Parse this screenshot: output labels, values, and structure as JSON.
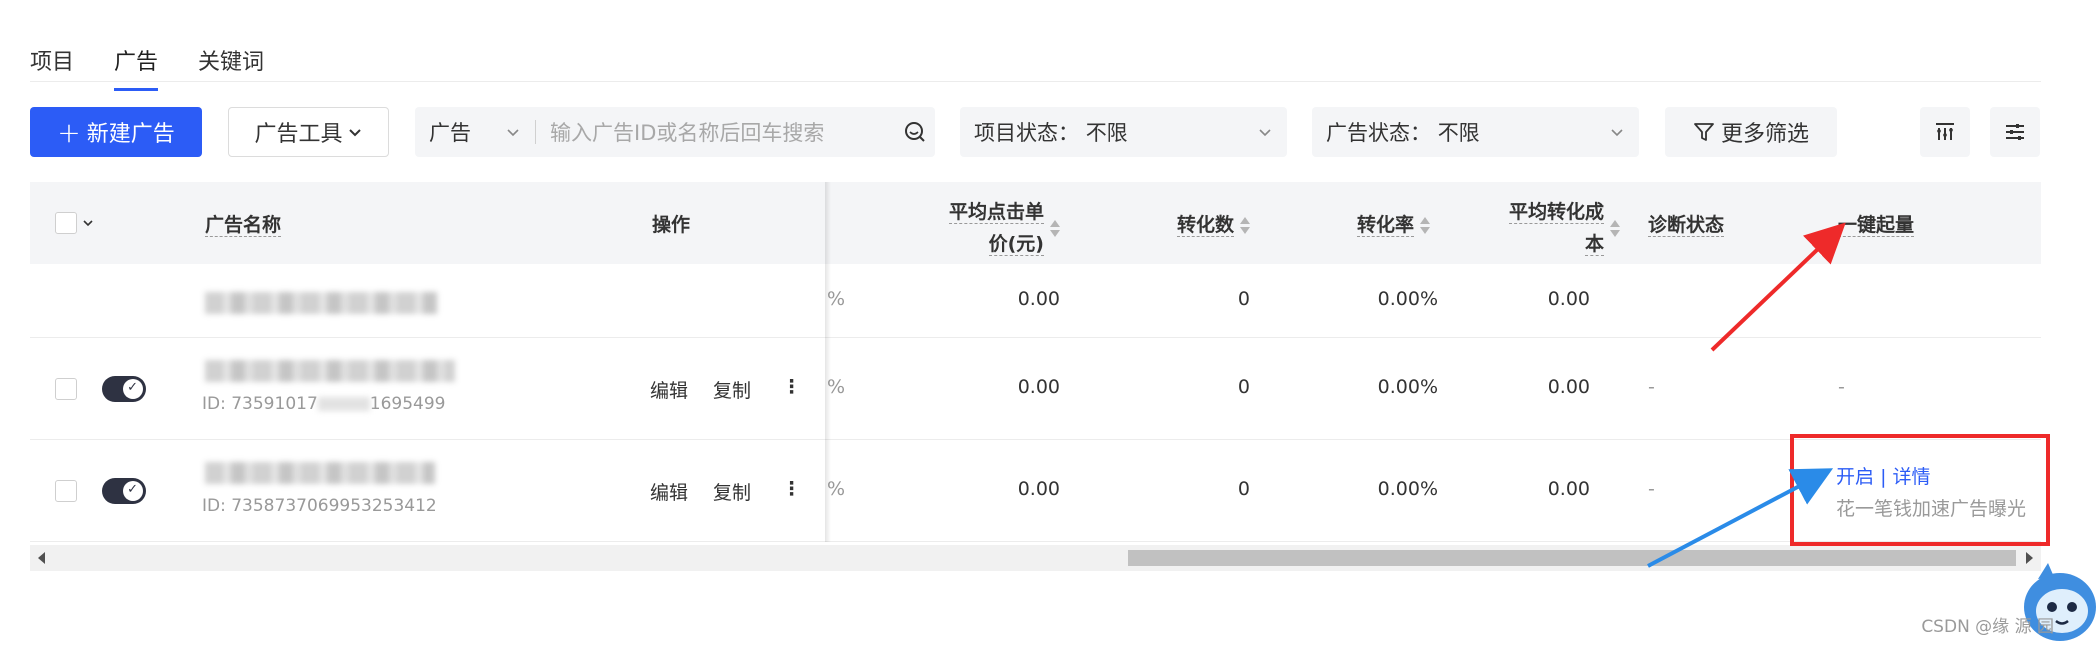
{
  "tabs": [
    {
      "label": "项目"
    },
    {
      "label": "广告",
      "active": true
    },
    {
      "label": "关键词"
    }
  ],
  "toolbar": {
    "new_ad_label": "新建广告",
    "ad_tools_label": "广告工具",
    "search_scope": "广告",
    "search_placeholder": "输入广告ID或名称后回车搜索",
    "project_status_label": "项目状态：",
    "project_status_value": "不限",
    "ad_status_label": "广告状态：",
    "ad_status_value": "不限",
    "more_filters_label": "更多筛选"
  },
  "table": {
    "headers": {
      "name": "广告名称",
      "actions": "操作",
      "partial": "",
      "avg_cpc": [
        "平均点击单",
        "价(元)"
      ],
      "conversions": "转化数",
      "conv_rate": "转化率",
      "avg_cpa": [
        "平均转化成",
        "本"
      ],
      "diagnosis": "诊断状态",
      "boost": "一键起量"
    },
    "rows": [
      {
        "partial": "%",
        "avg_cpc": "0.00",
        "conversions": "0",
        "conv_rate": "0.00%",
        "avg_cpa": "0.00",
        "diagnosis": "",
        "boost": ""
      },
      {
        "id_text": "ID: 73591017",
        "id_tail": "1695499",
        "edit": "编辑",
        "copy": "复制",
        "more": "⋮",
        "partial": "%",
        "avg_cpc": "0.00",
        "conversions": "0",
        "conv_rate": "0.00%",
        "avg_cpa": "0.00",
        "diagnosis": "-",
        "boost": "-"
      },
      {
        "id_text": "ID: 7358737069953253412",
        "edit": "编辑",
        "copy": "复制",
        "more": "⋮",
        "partial": "%",
        "avg_cpc": "0.00",
        "conversions": "0",
        "conv_rate": "0.00%",
        "avg_cpa": "0.00",
        "diagnosis": "-",
        "boost_open": "开启",
        "boost_sep": "|",
        "boost_detail": "详情",
        "boost_desc": "花一笔钱加速广告曝光"
      }
    ]
  },
  "watermark": "CSDN @缘  源  园",
  "colors": {
    "primary": "#2c5cf6",
    "annotation_red": "#ee2a2a",
    "annotation_blue": "#2a8be8"
  },
  "icons": [
    "plus-icon",
    "chevron-down-icon",
    "search-icon",
    "filter-icon",
    "column-settings-icon",
    "sliders-icon",
    "more-vertical-icon",
    "sort-icon"
  ]
}
